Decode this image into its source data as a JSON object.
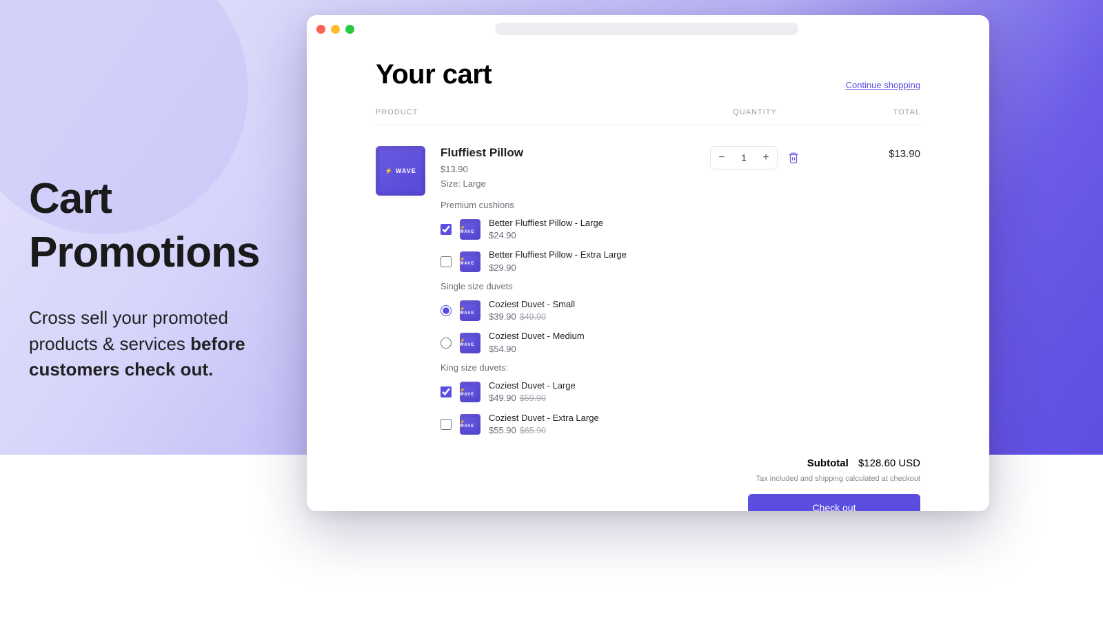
{
  "hero": {
    "title_line1": "Cart",
    "title_line2": "Promotions",
    "subtext_pre": "Cross sell your promoted products & services ",
    "subtext_strong": "before customers check out."
  },
  "cart": {
    "title": "Your cart",
    "continue_label": "Continue shopping",
    "col_product": "PRODUCT",
    "col_qty": "QUANTITY",
    "col_total": "TOTAL",
    "item": {
      "name": "Fluffiest Pillow",
      "price": "$13.90",
      "meta": "Size: Large",
      "thumb_text": "⚡ WAVE",
      "qty": "1",
      "line_total": "$13.90"
    },
    "groups": [
      {
        "title": "Premium cushions",
        "type": "checkbox",
        "options": [
          {
            "label": "Better Fluffiest Pillow - Large",
            "price": "$24.90",
            "checked": true
          },
          {
            "label": "Better Fluffiest Pillow - Extra Large",
            "price": "$29.90",
            "checked": false
          }
        ]
      },
      {
        "title": "Single size duvets",
        "type": "radio",
        "options": [
          {
            "label": "Coziest Duvet - Small",
            "price": "$39.90",
            "compare": "$49.90",
            "checked": true
          },
          {
            "label": "Coziest Duvet - Medium",
            "price": "$54.90",
            "checked": false
          }
        ]
      },
      {
        "title": "King size duvets:",
        "type": "checkbox",
        "options": [
          {
            "label": "Coziest Duvet - Large",
            "price": "$49.90",
            "compare": "$59.90",
            "checked": true
          },
          {
            "label": "Coziest Duvet - Extra Large",
            "price": "$55.90",
            "compare": "$65.90",
            "checked": false
          }
        ]
      }
    ],
    "subtotal_label": "Subtotal",
    "subtotal_value": "$128.60 USD",
    "tax_note": "Tax included and shipping calculated at checkout",
    "checkout_label": "Check out"
  },
  "thumb_text": "⚡ WAVE"
}
